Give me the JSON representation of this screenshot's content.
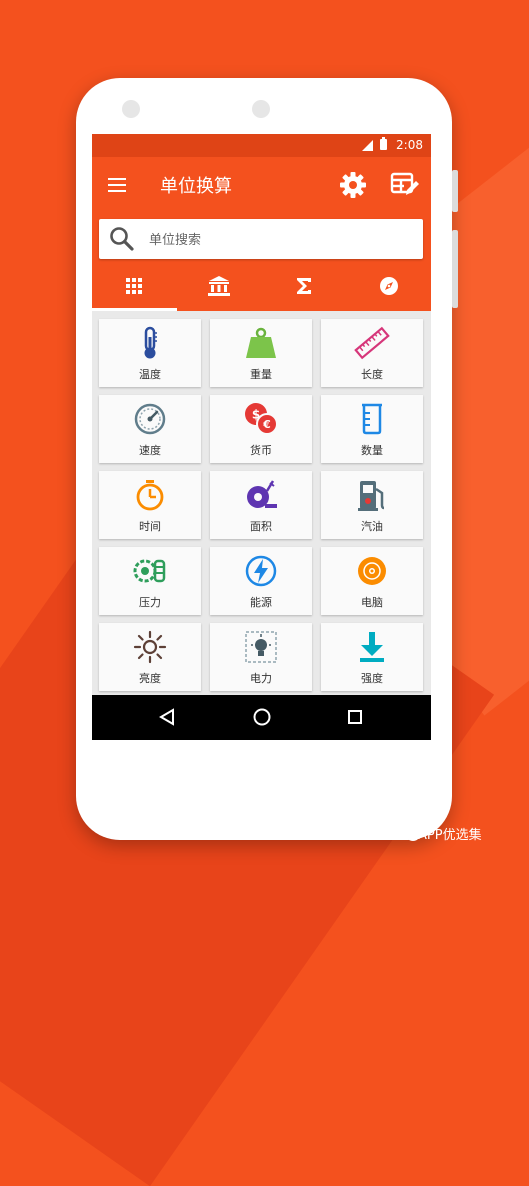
{
  "status_bar": {
    "time": "2:08"
  },
  "app_bar": {
    "title": "单位换算",
    "menu_icon": "hamburger-menu-icon",
    "settings_icon": "gear-icon",
    "edit_icon": "grid-edit-icon"
  },
  "search": {
    "placeholder": "单位搜索",
    "icon": "search-icon"
  },
  "tabs": [
    {
      "icon": "grid-icon",
      "active": true
    },
    {
      "icon": "bank-icon",
      "active": false
    },
    {
      "icon": "sigma-icon",
      "active": false
    },
    {
      "icon": "compass-icon",
      "active": false
    }
  ],
  "categories": [
    {
      "label": "温度",
      "icon": "thermometer-icon"
    },
    {
      "label": "重量",
      "icon": "weight-icon"
    },
    {
      "label": "长度",
      "icon": "ruler-icon"
    },
    {
      "label": "速度",
      "icon": "speedometer-icon"
    },
    {
      "label": "货币",
      "icon": "currency-icon"
    },
    {
      "label": "数量",
      "icon": "beaker-icon"
    },
    {
      "label": "时间",
      "icon": "stopwatch-icon"
    },
    {
      "label": "面积",
      "icon": "tape-measure-icon"
    },
    {
      "label": "汽油",
      "icon": "gas-pump-icon"
    },
    {
      "label": "压力",
      "icon": "pressure-icon"
    },
    {
      "label": "能源",
      "icon": "lightning-icon"
    },
    {
      "label": "电脑",
      "icon": "disc-icon"
    },
    {
      "label": "亮度",
      "icon": "sun-icon"
    },
    {
      "label": "电力",
      "icon": "bulb-icon"
    },
    {
      "label": "强度",
      "icon": "download-arrow-icon"
    }
  ],
  "nav_bar": {
    "back_icon": "back-triangle-icon",
    "home_icon": "home-circle-icon",
    "recents_icon": "recents-square-icon"
  },
  "watermark": {
    "text": "APP优选集"
  },
  "colors": {
    "primary": "#f4511e",
    "status_bar": "#df4416",
    "background": "#f4511e"
  }
}
